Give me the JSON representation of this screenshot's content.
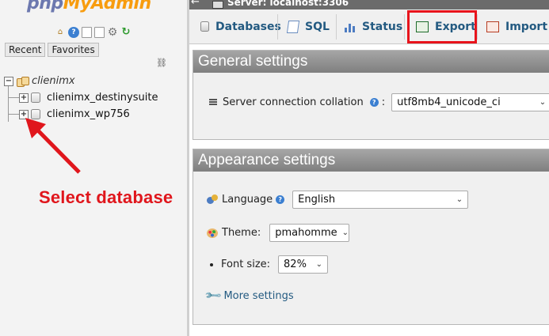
{
  "logo": {
    "part1": "php",
    "part2": "MyAdmin"
  },
  "nav": {
    "tabs": [
      "Recent",
      "Favorites"
    ],
    "tree_root": "clienimx",
    "databases": [
      "clienimx_destinysuite",
      "clienimx_wp756"
    ]
  },
  "annotation": {
    "text": "Select database",
    "color": "#e0161c"
  },
  "topbar": {
    "server": "Server: localhost:3306"
  },
  "menu": {
    "databases": "Databases",
    "sql": "SQL",
    "status": "Status",
    "export": "Export",
    "import": "Import"
  },
  "general_settings": {
    "title": "General settings",
    "collation_label": "Server connection collation",
    "collation_value": "utf8mb4_unicode_ci"
  },
  "appearance_settings": {
    "title": "Appearance settings",
    "language_label": "Language",
    "language_value": "English",
    "theme_label": "Theme:",
    "theme_value": "pmahomme",
    "fontsize_label": "Font size:",
    "fontsize_value": "82%",
    "more_settings": "More settings"
  },
  "colors": {
    "accent": "#235a81",
    "highlight": "#e8141c",
    "header": "#8e8e8e"
  }
}
